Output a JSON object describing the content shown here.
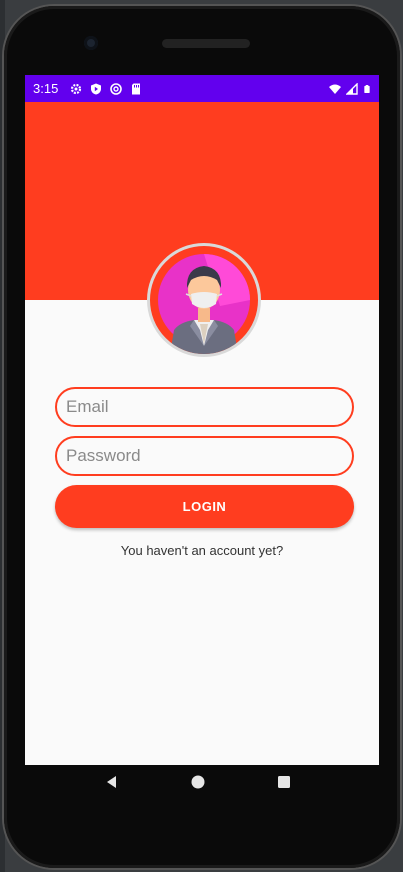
{
  "status_bar": {
    "time": "3:15",
    "left_icons": [
      "gear-icon",
      "shield-play-icon",
      "at-sign-icon",
      "sd-card-icon"
    ],
    "right_icons": [
      "wifi-icon",
      "signal-icon",
      "battery-icon"
    ]
  },
  "colors": {
    "status_bar": "#6200ee",
    "accent": "#ff3d1f",
    "background": "#fafafa"
  },
  "form": {
    "email_placeholder": "Email",
    "email_value": "",
    "password_placeholder": "Password",
    "password_value": "",
    "login_label": "LOGIN",
    "signup_text": "You haven't an account yet?"
  },
  "nav_bar": {
    "buttons": [
      "back-icon",
      "home-icon",
      "recents-icon"
    ]
  }
}
